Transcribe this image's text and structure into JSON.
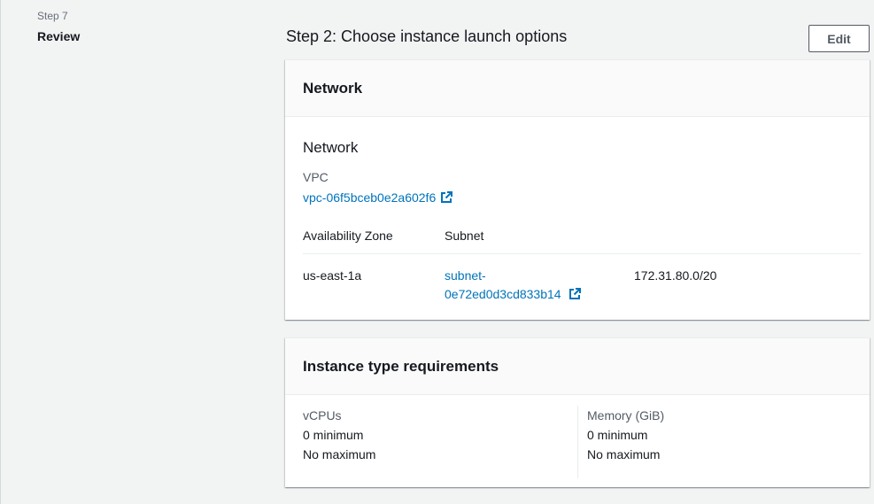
{
  "sidebar": {
    "step_number": "Step 7",
    "step_title": "Review"
  },
  "main": {
    "section_heading": "Step 2: Choose instance launch options",
    "edit_label": "Edit"
  },
  "network_card": {
    "header": "Network",
    "sub_title": "Network",
    "vpc_label": "VPC",
    "vpc_value": "vpc-06f5bceb0e2a602f6",
    "columns": [
      "Availability Zone",
      "Subnet"
    ],
    "row": {
      "zone": "us-east-1a",
      "subnet_line1": "subnet-",
      "subnet_line2": "0e72ed0d3cd833b14",
      "cidr": "172.31.80.0/20"
    },
    "external_link_icon": "external-link-icon"
  },
  "instance_card": {
    "header": "Instance type requirements",
    "vcpus": {
      "label": "vCPUs",
      "min": "0 minimum",
      "max": "No maximum"
    },
    "memory": {
      "label": "Memory (GiB)",
      "min": "0 minimum",
      "max": "No maximum"
    }
  },
  "colors": {
    "link": "#0073bb",
    "background": "#f2f3f3",
    "card": "#ffffff",
    "card_header": "#fafafa"
  }
}
